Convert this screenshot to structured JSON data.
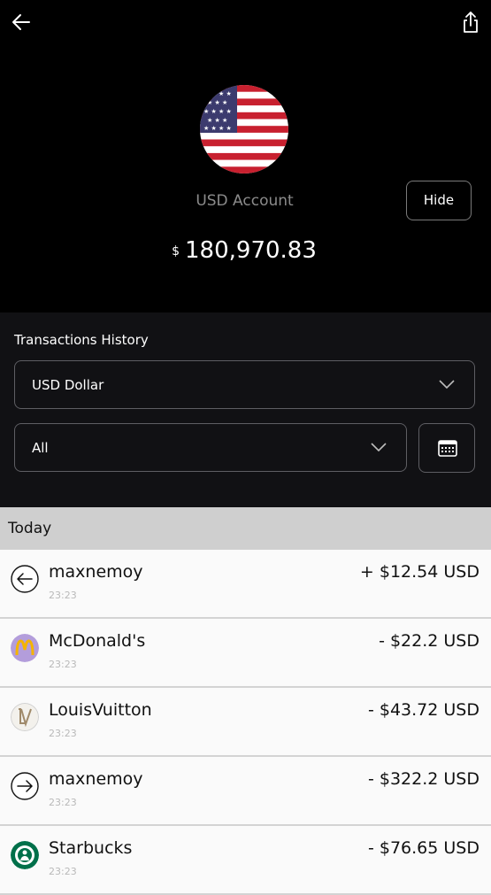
{
  "header": {
    "back_icon": "arrow-left-icon",
    "share_icon": "share-icon",
    "flag_icon": "us-flag-icon",
    "account_label": "USD Account",
    "hide_label": "Hide",
    "currency_symbol": "$",
    "balance": "180,970.83"
  },
  "filters": {
    "title": "Transactions History",
    "currency_select": "USD Dollar",
    "type_select": "All",
    "calendar_icon": "calendar-icon"
  },
  "transactions": {
    "group_label": "Today",
    "items": [
      {
        "name": "maxnemoy",
        "time": "23:23",
        "amount": "+ $12.54 USD",
        "icon": "incoming-arrow-icon"
      },
      {
        "name": "McDonald's",
        "time": "23:23",
        "amount": "- $22.2 USD",
        "icon": "mcdonalds-logo-icon"
      },
      {
        "name": "LouisVuitton",
        "time": "23:23",
        "amount": "- $43.72 USD",
        "icon": "louis-vuitton-logo-icon"
      },
      {
        "name": "maxnemoy",
        "time": "23:23",
        "amount": "- $322.2 USD",
        "icon": "outgoing-arrow-icon"
      },
      {
        "name": "Starbucks",
        "time": "23:23",
        "amount": "- $76.65 USD",
        "icon": "starbucks-logo-icon"
      }
    ]
  },
  "colors": {
    "top_background": "#000000",
    "filters_background": "#111114",
    "list_background": "#fafafa",
    "group_header": "#cfcfcf",
    "muted_text": "#8b8b8b"
  }
}
